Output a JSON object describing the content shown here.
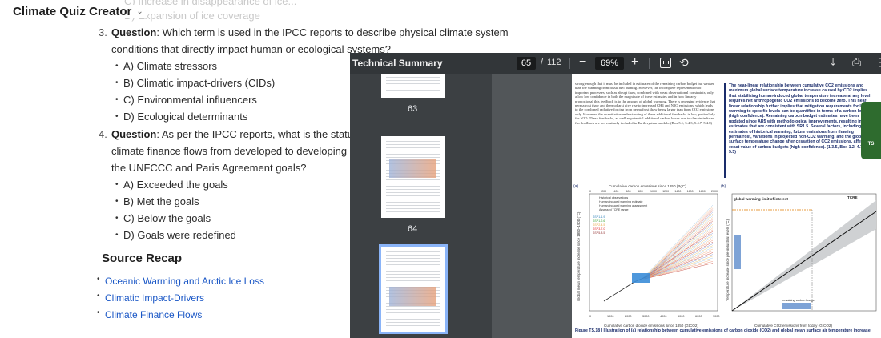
{
  "app": {
    "title": "Climate Quiz Creator"
  },
  "ghost_lines": [
    "C) Increase in disappearance of ice...",
    "D) Expansion of ice coverage"
  ],
  "questions": [
    {
      "number": "3.",
      "label": "Question",
      "text_line1": ": Which term is used in the IPCC reports to describe physical climate system",
      "text_line2": "conditions that directly impact human or ecological systems?",
      "options": [
        "A) Climate stressors",
        "B) Climatic impact-drivers (CIDs)",
        "C) Environmental influencers",
        "D) Ecological determinants"
      ]
    },
    {
      "number": "4.",
      "label": "Question",
      "text_line1": ": As per the IPCC reports, what is the status of publ",
      "text_line2": "climate finance flows from developed to developing countrie",
      "text_line3": "the UNFCCC and Paris Agreement goals?",
      "options": [
        "A) Exceeded the goals",
        "B) Met the goals",
        "C) Below the goals",
        "D) Goals were redefined"
      ]
    }
  ],
  "recap": {
    "title": "Source Recap",
    "links": [
      "Oceanic Warming and Arctic Ice Loss",
      "Climatic Impact-Drivers",
      "Climate Finance Flows"
    ]
  },
  "viewer": {
    "title": "Technical Summary",
    "current_page": "65",
    "separator": "/",
    "total_pages": "112",
    "zoom": "69%",
    "zoom_minus": "−",
    "zoom_plus": "+",
    "thumb_labels": [
      "63",
      "64"
    ],
    "side_tab": "TS",
    "page_body": "strong enough that it must be included in estimates of the remaining carbon budget but weaker than the warming from fossil fuel burning. However, the incomplete representation of important processes, such as abrupt thaw, combined with weak observational constraints, only allow low confidence in both the magnitude of these estimates and in how linearly proportional this feedback is to the amount of global warming. There is emerging evidence that permafrost thaw and thermokarst give rise to increased CH4 and N2O emissions, which leads to the combined radiative forcing from permafrost thaw being larger than from CO2 emissions only. However, the quantitative understanding of these additional feedbacks is low, particularly for N2O. These feedbacks, as well as potential additional carbon losses due to climate-induced fire feedback are not routinely included in Earth system models. (Box 5.1, 5.4.3, 5.4.7, 5.4.8)",
    "page_box": "The near-linear relationship between cumulative CO2 emissions and maximum global surface temperature increase caused by CO2 implies that stabilizing human-induced global temperature increase at any level requires net anthropogenic CO2 emissions to become zero. This near-linear relationship further implies that mitigation requirements for limiting warming to specific levels can be quantified in terms of a carbon budget (high confidence). Remaining carbon budget estimates have been updated since AR5 with methodological improvements, resulting in larger estimates that are consistent with SR1.5. Several factors, including estimates of historical warming, future emissions from thawing permafrost, variations in projected non-CO2 warming, and the global surface temperature change after cessation of CO2 emissions, affect the exact value of carbon budgets (high confidence). (1.3.5, Box 1.2, 4.7.1, 5.5)",
    "fig_a_label": "(a)",
    "fig_b_label": "(b)",
    "fig_a_top_axis": "Cumulative carbon emissions since 1850 (PgC)",
    "fig_a_xlabel": "Cumulative carbon dioxide emissions since 1850 (GtCO2)",
    "fig_a_ylabel": "Global mean temperature increase since 1850–1900 (°C)",
    "fig_b_xlabel": "Cumulative CO2 emissions from today (GtCO2)",
    "fig_b_ylabel": "Temperature increase since pre-industrial levels (°C)",
    "fig_b_limit": "global warming limit of interest",
    "fig_b_tcre": "TCRE",
    "fig_b_remaining": "remaining carbon budget",
    "fig_a_legend": [
      "Historical observations",
      "Human-induced warming estimate",
      "Human-induced warming assessment",
      "Assessed TCRE range"
    ],
    "fig_a_scenarios": [
      "SSP1-1.9",
      "SSP1-2.6",
      "SSP2-4.5",
      "SSP3-7.0",
      "SSP5-8.5"
    ],
    "fig_a_top_ticks": [
      "0",
      "200",
      "400",
      "600",
      "800",
      "1000",
      "1200",
      "1400",
      "1600",
      "1800",
      "2000"
    ],
    "fig_a_bottom_ticks": [
      "0",
      "1000",
      "2000",
      "3000",
      "4000",
      "5000",
      "6000",
      "7000"
    ],
    "caption": "Figure TS.18 | Illustration of (a) relationship between cumulative emissions of carbon dioxide (CO2) and global mean surface air temperature increase"
  },
  "colors": {
    "link": "#1a57c6",
    "viewer_bg": "#525659",
    "toolbar": "#323639",
    "accent_green": "#2e6b2e"
  }
}
